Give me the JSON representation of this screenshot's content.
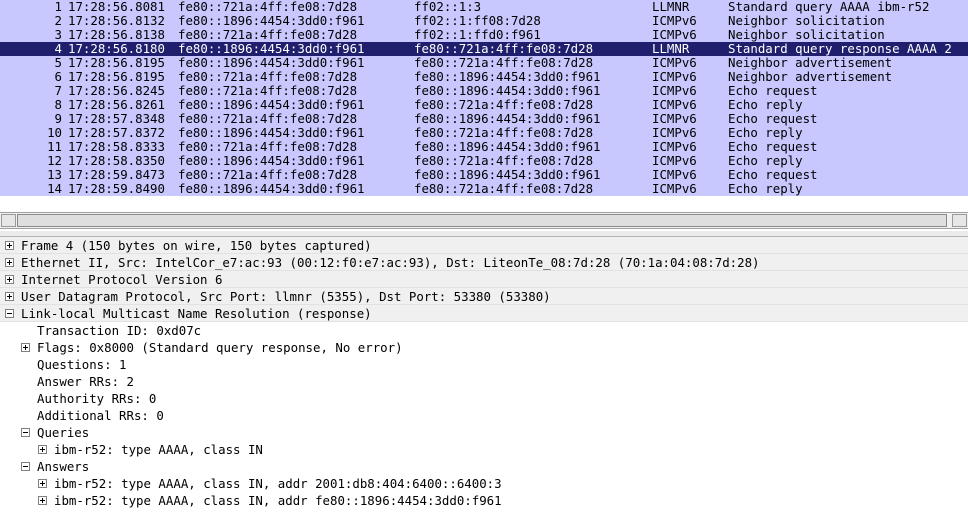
{
  "packets": [
    {
      "no": "1",
      "time": "17:28:56.8081",
      "src": "fe80::721a:4ff:fe08:7d28",
      "dst": "ff02::1:3",
      "proto": "LLMNR",
      "info": "Standard query AAAA ibm-r52"
    },
    {
      "no": "2",
      "time": "17:28:56.8132",
      "src": "fe80::1896:4454:3dd0:f961",
      "dst": "ff02::1:ff08:7d28",
      "proto": "ICMPv6",
      "info": "Neighbor solicitation"
    },
    {
      "no": "3",
      "time": "17:28:56.8138",
      "src": "fe80::721a:4ff:fe08:7d28",
      "dst": "ff02::1:ffd0:f961",
      "proto": "ICMPv6",
      "info": "Neighbor solicitation"
    },
    {
      "no": "4",
      "time": "17:28:56.8180",
      "src": "fe80::1896:4454:3dd0:f961",
      "dst": "fe80::721a:4ff:fe08:7d28",
      "proto": "LLMNR",
      "info": "Standard query response AAAA 2",
      "selected": true
    },
    {
      "no": "5",
      "time": "17:28:56.8195",
      "src": "fe80::1896:4454:3dd0:f961",
      "dst": "fe80::721a:4ff:fe08:7d28",
      "proto": "ICMPv6",
      "info": "Neighbor advertisement"
    },
    {
      "no": "6",
      "time": "17:28:56.8195",
      "src": "fe80::721a:4ff:fe08:7d28",
      "dst": "fe80::1896:4454:3dd0:f961",
      "proto": "ICMPv6",
      "info": "Neighbor advertisement"
    },
    {
      "no": "7",
      "time": "17:28:56.8245",
      "src": "fe80::721a:4ff:fe08:7d28",
      "dst": "fe80::1896:4454:3dd0:f961",
      "proto": "ICMPv6",
      "info": "Echo request"
    },
    {
      "no": "8",
      "time": "17:28:56.8261",
      "src": "fe80::1896:4454:3dd0:f961",
      "dst": "fe80::721a:4ff:fe08:7d28",
      "proto": "ICMPv6",
      "info": "Echo reply"
    },
    {
      "no": "9",
      "time": "17:28:57.8348",
      "src": "fe80::721a:4ff:fe08:7d28",
      "dst": "fe80::1896:4454:3dd0:f961",
      "proto": "ICMPv6",
      "info": "Echo request"
    },
    {
      "no": "10",
      "time": "17:28:57.8372",
      "src": "fe80::1896:4454:3dd0:f961",
      "dst": "fe80::721a:4ff:fe08:7d28",
      "proto": "ICMPv6",
      "info": "Echo reply"
    },
    {
      "no": "11",
      "time": "17:28:58.8333",
      "src": "fe80::721a:4ff:fe08:7d28",
      "dst": "fe80::1896:4454:3dd0:f961",
      "proto": "ICMPv6",
      "info": "Echo request"
    },
    {
      "no": "12",
      "time": "17:28:58.8350",
      "src": "fe80::1896:4454:3dd0:f961",
      "dst": "fe80::721a:4ff:fe08:7d28",
      "proto": "ICMPv6",
      "info": "Echo reply"
    },
    {
      "no": "13",
      "time": "17:28:59.8473",
      "src": "fe80::721a:4ff:fe08:7d28",
      "dst": "fe80::1896:4454:3dd0:f961",
      "proto": "ICMPv6",
      "info": "Echo request"
    },
    {
      "no": "14",
      "time": "17:28:59.8490",
      "src": "fe80::1896:4454:3dd0:f961",
      "dst": "fe80::721a:4ff:fe08:7d28",
      "proto": "ICMPv6",
      "info": "Echo reply"
    }
  ],
  "details": [
    {
      "level": 0,
      "expander": "plus",
      "text": "Frame 4 (150 bytes on wire, 150 bytes captured)"
    },
    {
      "level": 0,
      "expander": "plus",
      "text": "Ethernet II, Src: IntelCor_e7:ac:93 (00:12:f0:e7:ac:93), Dst: LiteonTe_08:7d:28 (70:1a:04:08:7d:28)"
    },
    {
      "level": 0,
      "expander": "plus",
      "text": "Internet Protocol Version 6"
    },
    {
      "level": 0,
      "expander": "plus",
      "text": "User Datagram Protocol, Src Port: llmnr (5355), Dst Port: 53380 (53380)"
    },
    {
      "level": 0,
      "expander": "minus",
      "text": "Link-local Multicast Name Resolution (response)"
    },
    {
      "level": 1,
      "expander": "none",
      "text": "Transaction ID: 0xd07c"
    },
    {
      "level": 1,
      "expander": "plus",
      "text": "Flags: 0x8000 (Standard query response, No error)"
    },
    {
      "level": 1,
      "expander": "none",
      "text": "Questions: 1"
    },
    {
      "level": 1,
      "expander": "none",
      "text": "Answer RRs: 2"
    },
    {
      "level": 1,
      "expander": "none",
      "text": "Authority RRs: 0"
    },
    {
      "level": 1,
      "expander": "none",
      "text": "Additional RRs: 0"
    },
    {
      "level": 1,
      "expander": "minus",
      "text": "Queries"
    },
    {
      "level": 2,
      "expander": "plus",
      "text": "ibm-r52: type AAAA, class IN"
    },
    {
      "level": 1,
      "expander": "minus",
      "text": "Answers"
    },
    {
      "level": 2,
      "expander": "plus",
      "text": "ibm-r52: type AAAA, class IN, addr 2001:db8:404:6400::6400:3"
    },
    {
      "level": 2,
      "expander": "plus",
      "text": "ibm-r52: type AAAA, class IN, addr fe80::1896:4454:3dd0:f961"
    }
  ]
}
